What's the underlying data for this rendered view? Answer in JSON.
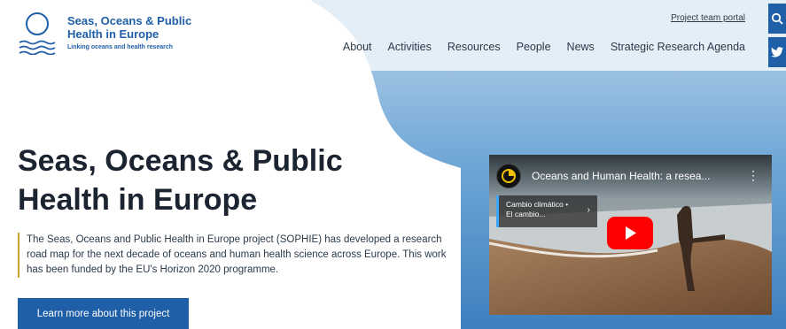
{
  "brand": {
    "title": "Seas, Oceans & Public Health in Europe",
    "tagline": "Linking oceans and health research"
  },
  "header": {
    "portal_link": "Project team portal",
    "nav": [
      "About",
      "Activities",
      "Resources",
      "People",
      "News",
      "Strategic Research Agenda"
    ],
    "search_icon": "search-icon",
    "social_icon": "twitter-icon"
  },
  "hero": {
    "title": "Seas, Oceans & Public Health in Europe",
    "body": "The Seas, Oceans and Public Health in Europe project (SOPHIE) has developed a research road map for the next decade of oceans and human health science across Europe. This work has been funded by the EU's Horizon 2020 programme.",
    "cta": "Learn more about this project"
  },
  "video": {
    "title": "Oceans and Human Health: a resea...",
    "card_line1": "Cambio climático •",
    "card_line2": "El cambio...",
    "menu_icon": "more-vert-icon",
    "play_icon": "youtube-play-icon"
  },
  "colors": {
    "primary": "#1f5fa8",
    "accent": "#c9a227",
    "text": "#1b2430"
  }
}
